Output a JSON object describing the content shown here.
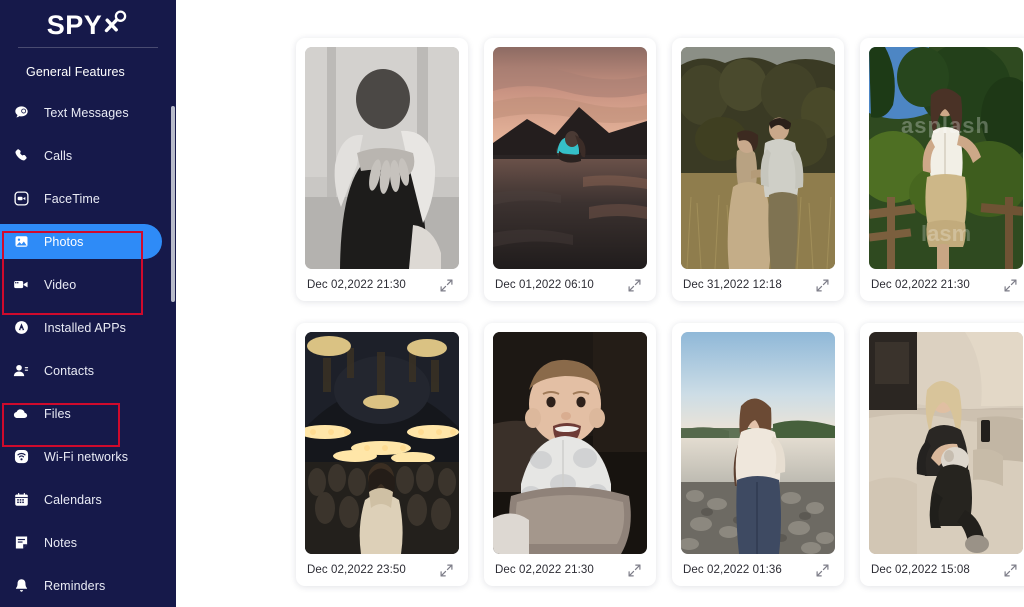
{
  "brand": {
    "name": "SPY",
    "mark_icon": "spyx-target-icon"
  },
  "sidebar": {
    "section_title": "General Features",
    "active_item": "Photos",
    "accent_color": "#2e8bf7",
    "background_color": "#16194a",
    "items": [
      {
        "label": "Text Messages",
        "icon": "chat-bubble-icon",
        "active": false
      },
      {
        "label": "Calls",
        "icon": "phone-icon",
        "active": false
      },
      {
        "label": "FaceTime",
        "icon": "facetime-video-icon",
        "active": false
      },
      {
        "label": "Photos",
        "icon": "photo-icon",
        "active": true
      },
      {
        "label": "Video",
        "icon": "video-camera-icon",
        "active": false
      },
      {
        "label": "Installed APPs",
        "icon": "apps-icon",
        "active": false
      },
      {
        "label": "Contacts",
        "icon": "contacts-icon",
        "active": false
      },
      {
        "label": "Files",
        "icon": "cloud-file-icon",
        "active": false
      },
      {
        "label": "Wi-Fi networks",
        "icon": "wifi-icon",
        "active": false
      },
      {
        "label": "Calendars",
        "icon": "calendar-icon",
        "active": false
      },
      {
        "label": "Notes",
        "icon": "notes-icon",
        "active": false
      },
      {
        "label": "Reminders",
        "icon": "bell-icon",
        "active": false
      }
    ]
  },
  "annotations": {
    "color": "#cf0a2c",
    "boxes": [
      {
        "id": "annot-photos-video",
        "covers": "Photos and Video menu items"
      },
      {
        "id": "annot-files",
        "covers": "Files menu item"
      }
    ]
  },
  "photos": {
    "expand_icon": "expand-diagonal-icon",
    "items": [
      {
        "timestamp": "Dec 02,2022 21:30",
        "scene": "black-and-white-couple-embracing",
        "watermark": ""
      },
      {
        "timestamp": "Dec 01,2022 06:10",
        "scene": "sunset-lake-woman-in-water",
        "watermark": ""
      },
      {
        "timestamp": "Dec 31,2022 12:18",
        "scene": "couple-in-golden-field",
        "watermark": ""
      },
      {
        "timestamp": "Dec 02,2022 21:30",
        "scene": "woman-by-garden-fence",
        "watermark": "unsplash"
      },
      {
        "timestamp": "Dec 02,2022 23:50",
        "scene": "crowd-in-grand-mosque-interior",
        "watermark": ""
      },
      {
        "timestamp": "Dec 02,2022 21:30",
        "scene": "smiling-baby-in-chair",
        "watermark": ""
      },
      {
        "timestamp": "Dec 02,2022 01:36",
        "scene": "woman-on-rocky-lake-shore",
        "watermark": ""
      },
      {
        "timestamp": "Dec 02,2022 15:08",
        "scene": "two-women-on-sofa-in-sunlight",
        "watermark": ""
      }
    ]
  }
}
